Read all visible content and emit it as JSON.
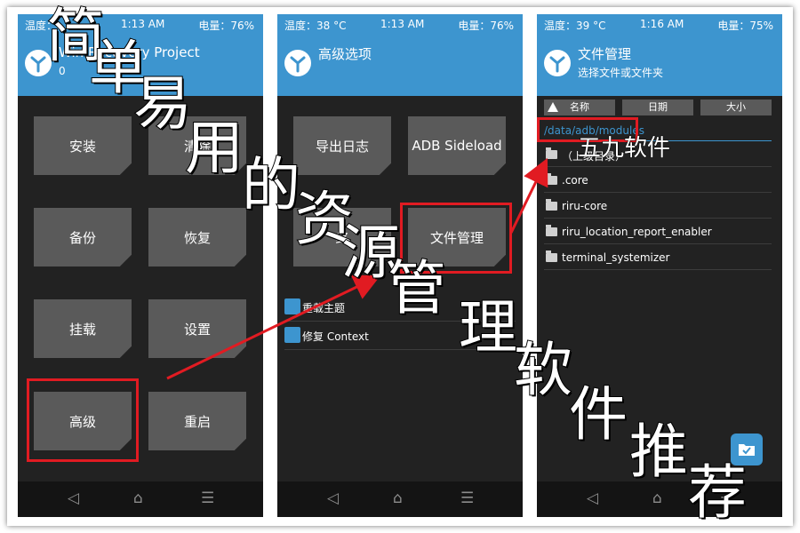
{
  "colors": {
    "accent": "#3d95cf",
    "panel_background": "#222222",
    "tile": "#5a5a5a",
    "highlight": "#e11b22"
  },
  "watermark": {
    "chars": [
      "简",
      "单",
      "易",
      "用",
      "的",
      "资",
      "源",
      "管",
      "理",
      "软",
      "件",
      "推",
      "荐"
    ],
    "label": "五九软件"
  },
  "screen_main": {
    "status": {
      "temp": "温度：",
      "time": "1:13 AM",
      "battery": "电量：76%"
    },
    "header": {
      "title": "Win Recovery Project",
      "subtitle": "0"
    },
    "tiles": [
      "安装",
      "清除",
      "备份",
      "恢复",
      "挂载",
      "设置",
      "高级",
      "重启"
    ],
    "nav": {
      "back": "◁",
      "home": "⌂",
      "menu": "☰"
    }
  },
  "screen_advanced": {
    "status": {
      "temp": "温度：38 °C",
      "time": "1:13 AM",
      "battery": "电量：76%"
    },
    "header": {
      "title": "高级选项"
    },
    "tiles": [
      "导出日志",
      "ADB Sideload",
      "终",
      "文件管理"
    ],
    "options": [
      "重载主题",
      "修复 Context"
    ],
    "nav": {
      "back": "◁",
      "home": "⌂",
      "menu": "☰"
    }
  },
  "screen_files": {
    "status": {
      "temp": "温度：39 °C",
      "time": "1:16 AM",
      "battery": "电量：75%"
    },
    "header": {
      "title": "文件管理",
      "subtitle": "选择文件或文件夹"
    },
    "sort": {
      "name": "名称",
      "date": "日期",
      "size": "大小"
    },
    "path": "/data/adb/modules",
    "files": [
      "（上级目录）",
      ".core",
      "riru-core",
      "riru_location_report_enabler",
      "terminal_systemizer"
    ],
    "nav": {
      "back": "◁",
      "home": "⌂",
      "menu": "☰"
    }
  }
}
